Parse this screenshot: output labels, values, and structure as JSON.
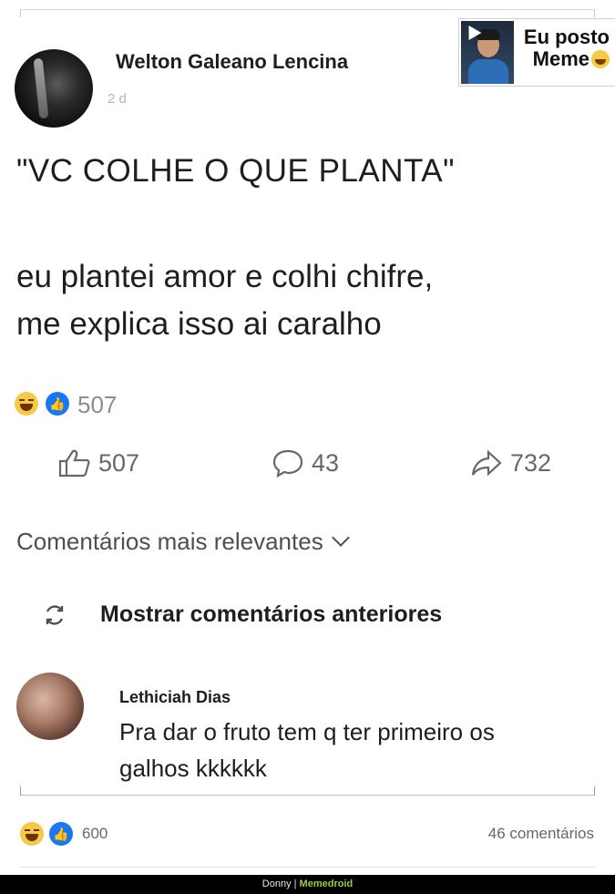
{
  "post": {
    "author": "Welton Galeano Lencina",
    "time": "2 d",
    "quote": "\"VC COLHE O QUE PLANTA\"",
    "body_line1": "eu plantei amor e colhi chifre,",
    "body_line2": "me explica isso ai caralho",
    "reaction_count": "507",
    "likes": "507",
    "comments": "43",
    "shares": "732"
  },
  "badge": {
    "line1": "Eu posto",
    "line2": "Meme"
  },
  "comments_section": {
    "sort_label": "Comentários mais relevantes",
    "show_previous": "Mostrar comentários anteriores",
    "comment": {
      "author": "Lethiciah Dias",
      "text_line1": "Pra dar o fruto tem q ter primeiro os",
      "text_line2": "galhos kkkkkk"
    }
  },
  "footer": {
    "reaction_count": "600",
    "comments_count": "46 comentários"
  },
  "watermark": {
    "user": "Donny",
    "separator": "|",
    "brand": "Memedroid"
  },
  "colors": {
    "like_blue": "#1877f2",
    "haha_yellow": "#f7c948",
    "muted_text": "#65676b",
    "watermark_brand": "#9acd32"
  },
  "icons": [
    "laugh-emoji-icon",
    "like-emoji-icon",
    "thumbs-up-icon",
    "comment-bubble-icon",
    "share-arrow-icon",
    "chevron-down-icon",
    "refresh-icon"
  ]
}
